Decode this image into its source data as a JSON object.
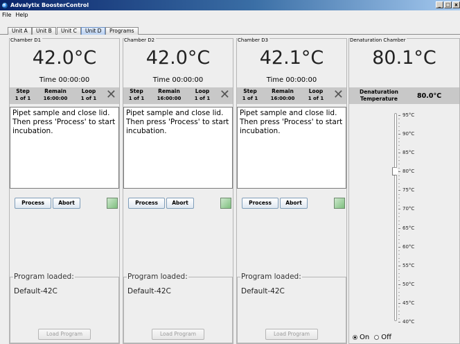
{
  "window": {
    "title": "Advalytix BoosterControl",
    "btn_min": "_",
    "btn_max": "□",
    "btn_close": "x"
  },
  "menu": [
    "File",
    "Help"
  ],
  "tabs": [
    {
      "label": "Unit A",
      "selected": false
    },
    {
      "label": "Unit B",
      "selected": false
    },
    {
      "label": "Unit C",
      "selected": false
    },
    {
      "label": "Unit D",
      "selected": true
    },
    {
      "label": "Programs",
      "selected": false
    }
  ],
  "chambers": [
    {
      "title": "Chamber D1",
      "temperature": "42.0°C",
      "time": "Time 00:00:00",
      "step_header": "Step",
      "step_value": "1 of 1",
      "remain_header": "Remain",
      "remain_value": "16:00:00",
      "loop_header": "Loop",
      "loop_value": "1 of 1",
      "message": "Pipet sample and close lid. Then press 'Process' to start incubation.",
      "process_label": "Process",
      "abort_label": "Abort",
      "program_label": "Program loaded:",
      "program_name": "Default-42C",
      "load_label": "Load Program"
    },
    {
      "title": "Chamber D2",
      "temperature": "42.0°C",
      "time": "Time 00:00:00",
      "step_header": "Step",
      "step_value": "1 of 1",
      "remain_header": "Remain",
      "remain_value": "16:00:00",
      "loop_header": "Loop",
      "loop_value": "1 of 1",
      "message": "Pipet sample and close lid. Then press 'Process' to start incubation.",
      "process_label": "Process",
      "abort_label": "Abort",
      "program_label": "Program loaded:",
      "program_name": "Default-42C",
      "load_label": "Load Program"
    },
    {
      "title": "Chamber D3",
      "temperature": "42.1°C",
      "time": "Time 00:00:00",
      "step_header": "Step",
      "step_value": "1 of 1",
      "remain_header": "Remain",
      "remain_value": "16:00:00",
      "loop_header": "Loop",
      "loop_value": "1 of 1",
      "message": "Pipet sample and close lid. Then press 'Process' to start incubation.",
      "process_label": "Process",
      "abort_label": "Abort",
      "program_label": "Program loaded:",
      "program_name": "Default-42C",
      "load_label": "Load Program"
    }
  ],
  "denaturation": {
    "title": "Denaturation Chamber",
    "temperature": "80.1°C",
    "label_line1": "Denaturation",
    "label_line2": "Temperature",
    "setpoint": "80.0°C",
    "slider_value": 80,
    "slider_min": 40,
    "slider_max": 95,
    "scale": [
      "95°C",
      "90°C",
      "85°C",
      "80°C",
      "75°C",
      "70°C",
      "65°C",
      "60°C",
      "55°C",
      "50°C",
      "45°C",
      "40°C"
    ],
    "on_label": "On",
    "off_label": "Off",
    "on_selected": true
  },
  "icons": {
    "close": "x-icon",
    "chart": "chart-icon",
    "app": "app-icon"
  }
}
